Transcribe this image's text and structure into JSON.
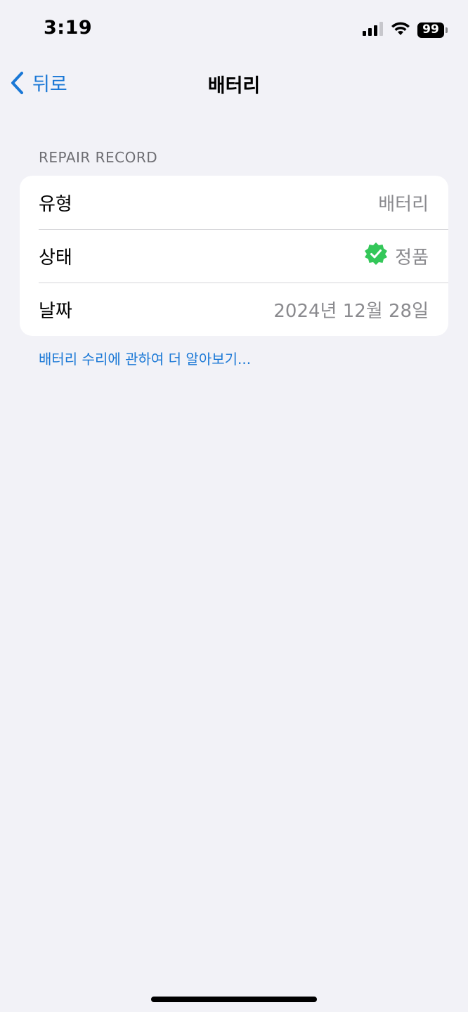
{
  "status_bar": {
    "time": "3:19",
    "battery_level": "99",
    "signal_icon": "cellular-signal-icon",
    "wifi_icon": "wifi-icon"
  },
  "nav": {
    "back_label": "뒤로",
    "title": "배터리"
  },
  "repair_record": {
    "header": "REPAIR RECORD",
    "rows": [
      {
        "label": "유형",
        "value": "배터리"
      },
      {
        "label": "상태",
        "value": "정품"
      },
      {
        "label": "날짜",
        "value": "2024년 12월 28일"
      }
    ]
  },
  "learn_more": "배터리 수리에 관하여 더 알아보기...",
  "colors": {
    "accent": "#1a78d6",
    "verified": "#34c759",
    "background": "#f2f2f7"
  }
}
